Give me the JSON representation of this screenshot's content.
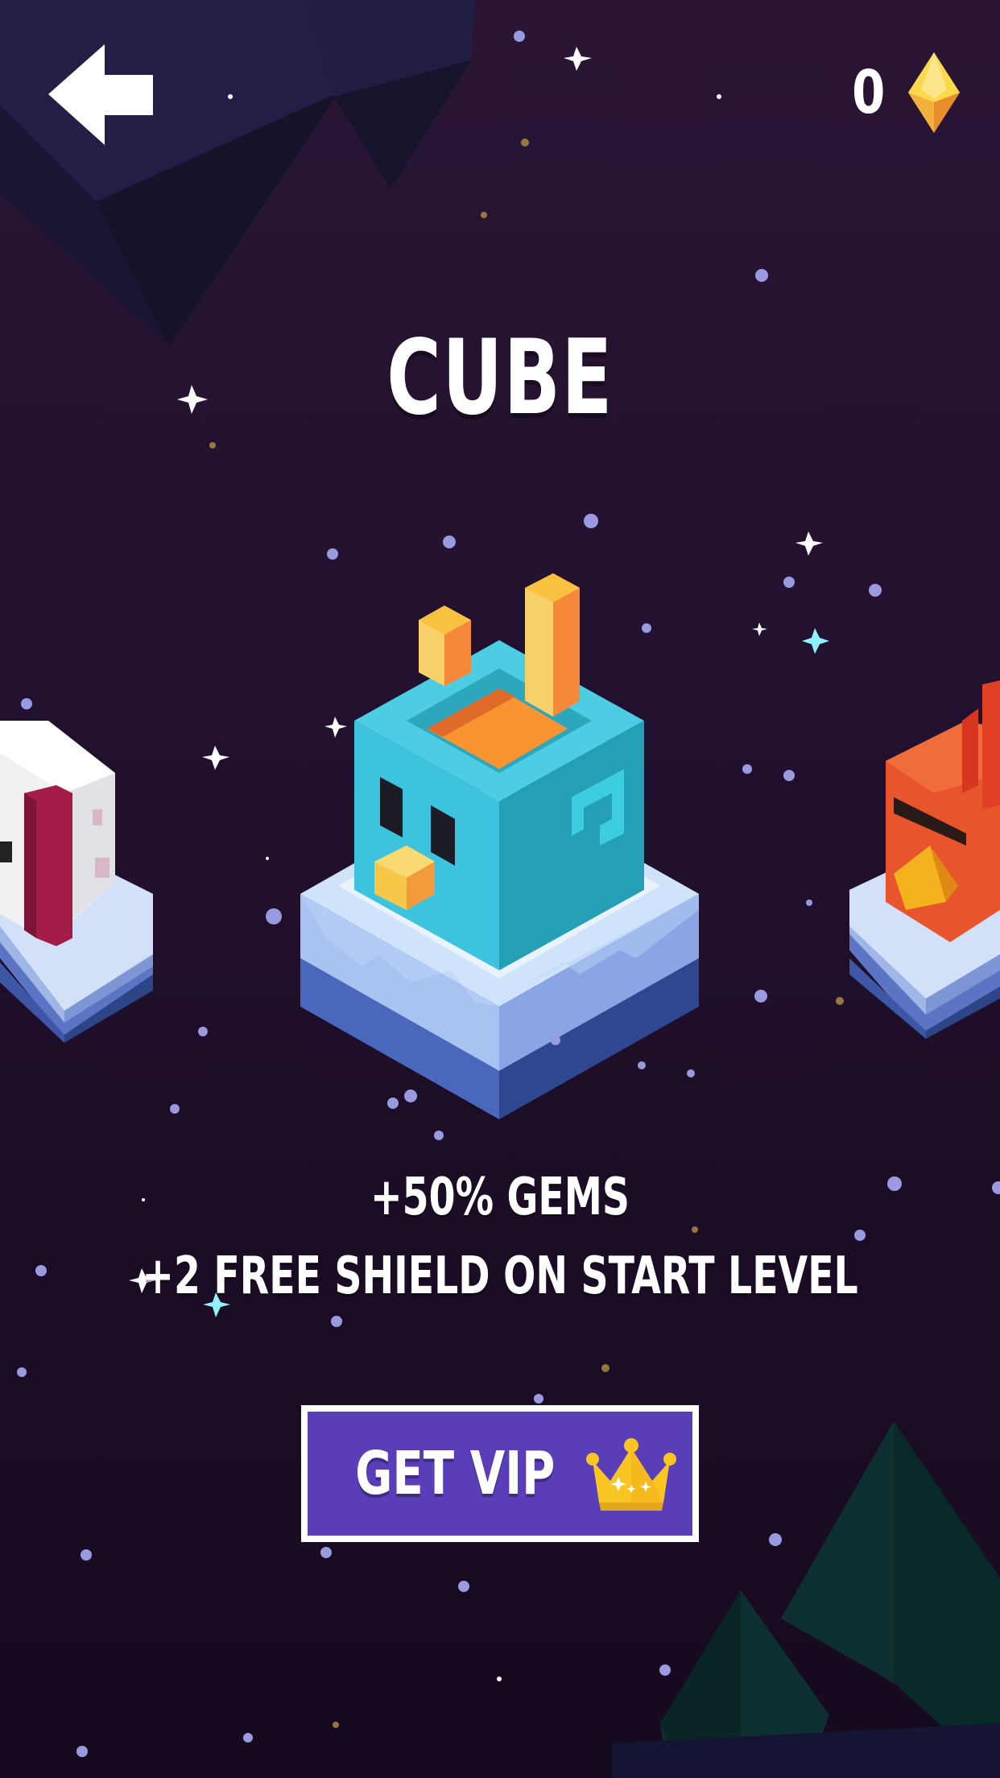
{
  "header": {
    "back_icon": "back-arrow-icon",
    "gem_count": "0",
    "gem_icon": "gem-icon"
  },
  "character": {
    "name": "CUBE",
    "perks": [
      "+50% GEMS",
      "+2 FREE SHIELD ON START LEVEL"
    ]
  },
  "carousel": {
    "left_preview": "white-yeti-character",
    "center": "blue-bird-cube-character",
    "right_preview": "red-bird-character"
  },
  "vip_button": {
    "label": "GET VIP",
    "icon": "crown-icon"
  },
  "colors": {
    "background": "#22112e",
    "button": "#5a3db8",
    "button_border": "#ffffff",
    "gem_top": "#f9d23a",
    "gem_bottom": "#f39a2e"
  }
}
